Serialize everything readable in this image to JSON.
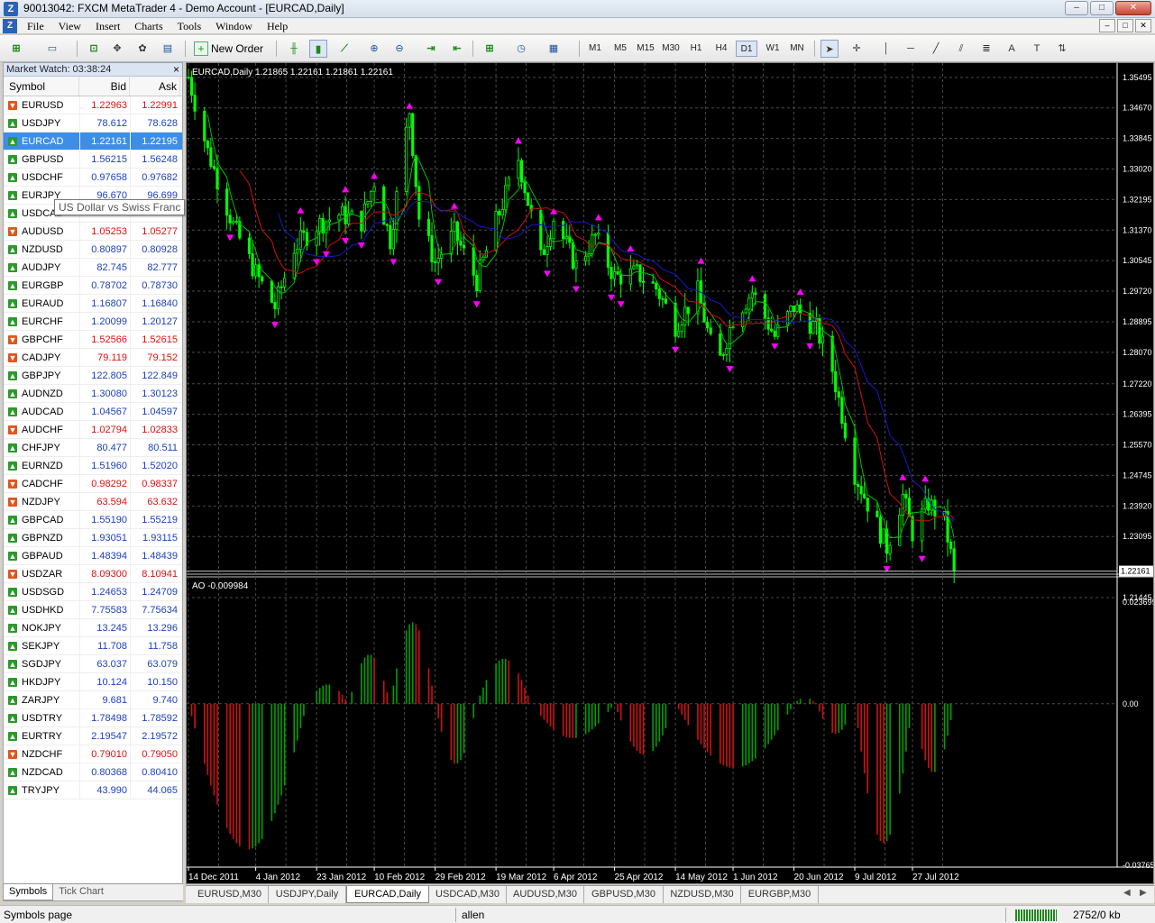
{
  "window": {
    "title": "90013042: FXCM MetaTrader 4 - Demo Account - [EURCAD,Daily]",
    "app_icon": "Z",
    "buttons": [
      "–",
      "□",
      "✕"
    ]
  },
  "menubar": {
    "items": [
      "File",
      "View",
      "Insert",
      "Charts",
      "Tools",
      "Window",
      "Help"
    ]
  },
  "toolbar": {
    "new_order_label": "New Order",
    "timeframes": [
      "M1",
      "M5",
      "M15",
      "M30",
      "H1",
      "H4",
      "D1",
      "W1",
      "MN"
    ],
    "active_timeframe": "D1"
  },
  "market_watch": {
    "title": "Market Watch: 03:38:24",
    "headers": {
      "symbol": "Symbol",
      "bid": "Bid",
      "ask": "Ask"
    },
    "rows": [
      {
        "symbol": "EURUSD",
        "bid": "1.22963",
        "ask": "1.22991",
        "dir": "down"
      },
      {
        "symbol": "USDJPY",
        "bid": "78.612",
        "ask": "78.628",
        "dir": "up"
      },
      {
        "symbol": "EURCAD",
        "bid": "1.22161",
        "ask": "1.22195",
        "dir": "up",
        "selected": true
      },
      {
        "symbol": "GBPUSD",
        "bid": "1.56215",
        "ask": "1.56248",
        "dir": "up"
      },
      {
        "symbol": "USDCHF",
        "bid": "0.97658",
        "ask": "0.97682",
        "dir": "up"
      },
      {
        "symbol": "EURJPY",
        "bid": "96.670",
        "ask": "96.699",
        "dir": "up"
      },
      {
        "symbol": "USDCAD",
        "bid": "",
        "ask": "",
        "dir": "up"
      },
      {
        "symbol": "AUDUSD",
        "bid": "1.05253",
        "ask": "1.05277",
        "dir": "down"
      },
      {
        "symbol": "NZDUSD",
        "bid": "0.80897",
        "ask": "0.80928",
        "dir": "up"
      },
      {
        "symbol": "AUDJPY",
        "bid": "82.745",
        "ask": "82.777",
        "dir": "up"
      },
      {
        "symbol": "EURGBP",
        "bid": "0.78702",
        "ask": "0.78730",
        "dir": "up"
      },
      {
        "symbol": "EURAUD",
        "bid": "1.16807",
        "ask": "1.16840",
        "dir": "up"
      },
      {
        "symbol": "EURCHF",
        "bid": "1.20099",
        "ask": "1.20127",
        "dir": "up"
      },
      {
        "symbol": "GBPCHF",
        "bid": "1.52566",
        "ask": "1.52615",
        "dir": "down"
      },
      {
        "symbol": "CADJPY",
        "bid": "79.119",
        "ask": "79.152",
        "dir": "down"
      },
      {
        "symbol": "GBPJPY",
        "bid": "122.805",
        "ask": "122.849",
        "dir": "up"
      },
      {
        "symbol": "AUDNZD",
        "bid": "1.30080",
        "ask": "1.30123",
        "dir": "up"
      },
      {
        "symbol": "AUDCAD",
        "bid": "1.04567",
        "ask": "1.04597",
        "dir": "up"
      },
      {
        "symbol": "AUDCHF",
        "bid": "1.02794",
        "ask": "1.02833",
        "dir": "down"
      },
      {
        "symbol": "CHFJPY",
        "bid": "80.477",
        "ask": "80.511",
        "dir": "up"
      },
      {
        "symbol": "EURNZD",
        "bid": "1.51960",
        "ask": "1.52020",
        "dir": "up"
      },
      {
        "symbol": "CADCHF",
        "bid": "0.98292",
        "ask": "0.98337",
        "dir": "down"
      },
      {
        "symbol": "NZDJPY",
        "bid": "63.594",
        "ask": "63.632",
        "dir": "down"
      },
      {
        "symbol": "GBPCAD",
        "bid": "1.55190",
        "ask": "1.55219",
        "dir": "up"
      },
      {
        "symbol": "GBPNZD",
        "bid": "1.93051",
        "ask": "1.93115",
        "dir": "up"
      },
      {
        "symbol": "GBPAUD",
        "bid": "1.48394",
        "ask": "1.48439",
        "dir": "up"
      },
      {
        "symbol": "USDZAR",
        "bid": "8.09300",
        "ask": "8.10941",
        "dir": "down"
      },
      {
        "symbol": "USDSGD",
        "bid": "1.24653",
        "ask": "1.24709",
        "dir": "up"
      },
      {
        "symbol": "USDHKD",
        "bid": "7.75583",
        "ask": "7.75634",
        "dir": "up"
      },
      {
        "symbol": "NOKJPY",
        "bid": "13.245",
        "ask": "13.296",
        "dir": "up"
      },
      {
        "symbol": "SEKJPY",
        "bid": "11.708",
        "ask": "11.758",
        "dir": "up"
      },
      {
        "symbol": "SGDJPY",
        "bid": "63.037",
        "ask": "63.079",
        "dir": "up"
      },
      {
        "symbol": "HKDJPY",
        "bid": "10.124",
        "ask": "10.150",
        "dir": "up"
      },
      {
        "symbol": "ZARJPY",
        "bid": "9.681",
        "ask": "9.740",
        "dir": "up"
      },
      {
        "symbol": "USDTRY",
        "bid": "1.78498",
        "ask": "1.78592",
        "dir": "up"
      },
      {
        "symbol": "EURTRY",
        "bid": "2.19547",
        "ask": "2.19572",
        "dir": "up"
      },
      {
        "symbol": "NZDCHF",
        "bid": "0.79010",
        "ask": "0.79050",
        "dir": "down"
      },
      {
        "symbol": "NZDCAD",
        "bid": "0.80368",
        "ask": "0.80410",
        "dir": "up"
      },
      {
        "symbol": "TRYJPY",
        "bid": "43.990",
        "ask": "44.065",
        "dir": "up"
      }
    ],
    "tooltip": "US Dollar vs Swiss Franc",
    "tabs": [
      "Symbols",
      "Tick Chart"
    ],
    "active_tab": "Symbols"
  },
  "chart_tabs": {
    "items": [
      "EURUSD,M30",
      "USDJPY,Daily",
      "EURCAD,Daily",
      "USDCAD,M30",
      "AUDUSD,M30",
      "GBPUSD,M30",
      "NZDUSD,M30",
      "EURGBP,M30"
    ],
    "active": "EURCAD,Daily"
  },
  "statusbar": {
    "left": "Symbols page",
    "profile": "allen",
    "traffic": "2752/0 kb"
  },
  "colors": {
    "chart_bg": "#000000",
    "candle": "#00ff00",
    "fractal": "#ff00ff",
    "ma_fast": "#00c000",
    "ma_mid": "#d01010",
    "ma_slow": "#1818c8",
    "ao_up": "#00a000",
    "ao_down": "#d01010",
    "grid": "#4a4a4a",
    "axis_text": "#ffffff"
  },
  "chart_data": [
    {
      "type": "candlestick",
      "title": "EURCAD,Daily",
      "ohlc_header": "1.21865 1.22161 1.21861 1.22161",
      "current_price_label": "1.22161",
      "current_price": 1.22161,
      "ylim": [
        1.21445,
        1.3588
      ],
      "yticks": [
        "1.35495",
        "1.34670",
        "1.33845",
        "1.33020",
        "1.32195",
        "1.31370",
        "1.30545",
        "1.29720",
        "1.28895",
        "1.28070",
        "1.27220",
        "1.26395",
        "1.25570",
        "1.24745",
        "1.23920",
        "1.23095",
        "1.21445"
      ],
      "xticks": [
        "14 Dec 2011",
        "4 Jan 2012",
        "23 Jan 2012",
        "10 Feb 2012",
        "29 Feb 2012",
        "19 Mar 2012",
        "6 Apr 2012",
        "25 Apr 2012",
        "14 May 2012",
        "1 Jun 2012",
        "20 Jun 2012",
        "9 Jul 2012",
        "27 Jul 2012"
      ],
      "close_path": [
        [
          "14 Dec 2011",
          1.355
        ],
        [
          "20 Dec 2011",
          1.335
        ],
        [
          "28 Dec 2011",
          1.315
        ],
        [
          "4 Jan 2012",
          1.302
        ],
        [
          "10 Jan 2012",
          1.293
        ],
        [
          "16 Jan 2012",
          1.309
        ],
        [
          "23 Jan 2012",
          1.315
        ],
        [
          "30 Jan 2012",
          1.318
        ],
        [
          "6 Feb 2012",
          1.316
        ],
        [
          "10 Feb 2012",
          1.327
        ],
        [
          "15 Feb 2012",
          1.311
        ],
        [
          "21 Feb 2012",
          1.346
        ],
        [
          "24 Feb 2012",
          1.317
        ],
        [
          "29 Feb 2012",
          1.305
        ],
        [
          "6 Mar 2012",
          1.313
        ],
        [
          "13 Mar 2012",
          1.3
        ],
        [
          "19 Mar 2012",
          1.316
        ],
        [
          "26 Mar 2012",
          1.333
        ],
        [
          "2 Apr 2012",
          1.306
        ],
        [
          "6 Apr 2012",
          1.317
        ],
        [
          "13 Apr 2012",
          1.304
        ],
        [
          "19 Apr 2012",
          1.312
        ],
        [
          "25 Apr 2012",
          1.301
        ],
        [
          "2 May 2012",
          1.302
        ],
        [
          "8 May 2012",
          1.298
        ],
        [
          "14 May 2012",
          1.288
        ],
        [
          "21 May 2012",
          1.297
        ],
        [
          "27 May 2012",
          1.276
        ],
        [
          "1 Jun 2012",
          1.29
        ],
        [
          "7 Jun 2012",
          1.297
        ],
        [
          "14 Jun 2012",
          1.285
        ],
        [
          "20 Jun 2012",
          1.293
        ],
        [
          "27 Jun 2012",
          1.287
        ],
        [
          "2 Jul 2012",
          1.276
        ],
        [
          "9 Jul 2012",
          1.248
        ],
        [
          "13 Jul 2012",
          1.24
        ],
        [
          "19 Jul 2012",
          1.228
        ],
        [
          "24 Jul 2012",
          1.242
        ],
        [
          "27 Jul 2012",
          1.232
        ],
        [
          "1 Aug 2012",
          1.24
        ],
        [
          "6 Aug 2012",
          1.235
        ],
        [
          "9 Aug 2012",
          1.22161
        ]
      ]
    },
    {
      "type": "bar",
      "title": "AO -0.009984",
      "ylim": [
        -0.037659,
        0.023699
      ],
      "yticks": [
        "0.023699",
        "0.00",
        "-0.037659"
      ],
      "zero_label": "0.00",
      "segments": [
        {
          "from": "14 Dec 2011",
          "to": "20 Jan 2012",
          "peak": -0.034
        },
        {
          "from": "20 Jan 2012",
          "to": "2 Feb 2012",
          "peak": 0.0045
        },
        {
          "from": "2 Feb 2012",
          "to": "15 Feb 2012",
          "peak": 0.0115
        },
        {
          "from": "15 Feb 2012",
          "to": "29 Feb 2012",
          "peak": 0.019
        },
        {
          "from": "29 Feb 2012",
          "to": "13 Mar 2012",
          "peak": -0.014
        },
        {
          "from": "13 Mar 2012",
          "to": "30 Mar 2012",
          "peak": 0.0105
        },
        {
          "from": "30 Mar 2012",
          "to": "25 Apr 2012",
          "peak": -0.008
        },
        {
          "from": "25 Apr 2012",
          "to": "14 May 2012",
          "peak": -0.012
        },
        {
          "from": "14 May 2012",
          "to": "20 Jun 2012",
          "peak": -0.015
        },
        {
          "from": "20 Jun 2012",
          "to": "27 Jun 2012",
          "peak": 0.0015
        },
        {
          "from": "27 Jun 2012",
          "to": "9 Jul 2012",
          "peak": -0.007
        },
        {
          "from": "9 Jul 2012",
          "to": "27 Jul 2012",
          "peak": -0.0325
        },
        {
          "from": "27 Jul 2012",
          "to": "9 Aug 2012",
          "peak": -0.016
        }
      ],
      "last_value": -0.009984
    }
  ]
}
